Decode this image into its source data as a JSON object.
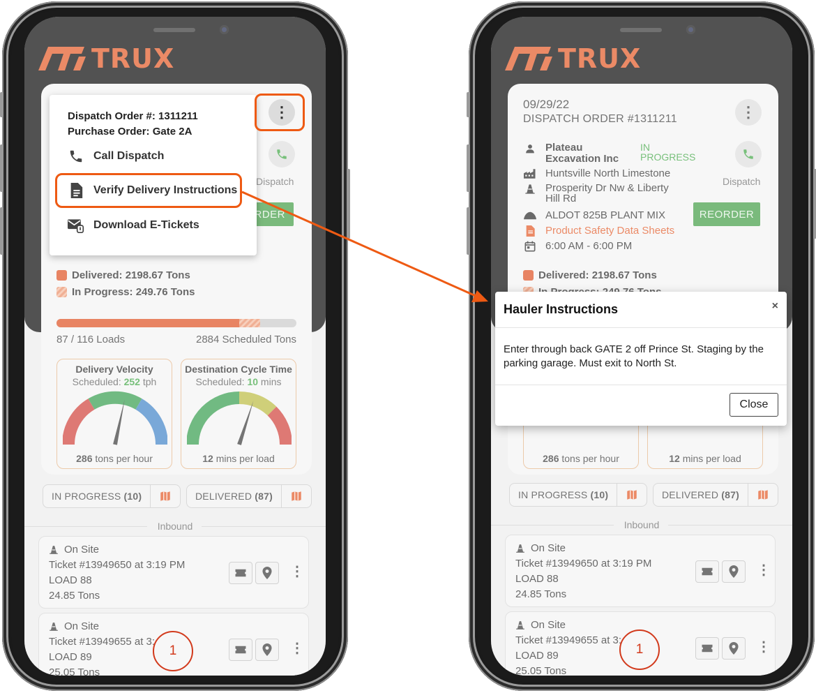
{
  "app": {
    "logo_text": "TRUX"
  },
  "left": {
    "menu": {
      "dispatch_order": "Dispatch Order #: 1311211",
      "purchase_order": "Purchase Order: Gate 2A",
      "call_dispatch": "Call Dispatch",
      "verify_instructions": "Verify Delivery Instructions",
      "download_etickets": "Download E-Tickets"
    }
  },
  "order": {
    "date": "09/29/22",
    "title": "DISPATCH ORDER #1311211",
    "customer": "Plateau Excavation Inc",
    "status": "IN PROGRESS",
    "plant": "Huntsville North Limestone",
    "location": "Prosperity Dr Nw & Liberty Hill Rd",
    "material": "ALDOT 825B PLANT MIX",
    "safety_link": "Product Safety Data Sheets",
    "hours": "6:00 AM - 6:00 PM",
    "dispatch_label": "Dispatch",
    "reorder_label": "REORDER",
    "reorder_partial": "RDER"
  },
  "progress": {
    "delivered_label": "Delivered: 2198.67 Tons",
    "in_progress_label": "In Progress: 249.76 Tons",
    "in_progress_partial": "In Progress: 249.76 Tons",
    "delivered_fraction": 0.762,
    "in_progress_fraction": 0.087,
    "loads_text": "87 / 116 Loads",
    "scheduled_text": "2884 Scheduled Tons"
  },
  "gauges": [
    {
      "title": "Delivery Velocity",
      "sub_prefix": "Scheduled:",
      "sub_value": "252",
      "sub_unit": "tph",
      "foot_value": "286",
      "foot_unit": "tons per hour",
      "needle_deg": 12
    },
    {
      "title": "Destination Cycle Time",
      "sub_prefix": "Scheduled:",
      "sub_value": "10",
      "sub_unit": "mins",
      "foot_value": "12",
      "foot_unit": "mins per load",
      "needle_deg": 18
    }
  ],
  "filters": {
    "in_progress": "IN PROGRESS",
    "in_progress_count": "(10)",
    "delivered": "DELIVERED",
    "delivered_count": "(87)"
  },
  "inbound_label": "Inbound",
  "loads": [
    {
      "status": "On Site",
      "ticket": "Ticket #13949650 at 3:19 PM",
      "load": "LOAD 88",
      "tons": "24.85 Tons"
    },
    {
      "status": "On Site",
      "ticket": "Ticket #13949655 at 3:",
      "load": "LOAD 89",
      "tons": "25.05 Tons"
    }
  ],
  "fab_count": "1",
  "modal": {
    "title": "Hauler Instructions",
    "close_x": "×",
    "body": "Enter through back GATE 2 off Prince St. Staging by the parking garage. Must exit to North St.",
    "close_button": "Close"
  },
  "colors": {
    "brand_orange": "#e2531e",
    "green": "#39a23d",
    "highlight": "#ee5a13"
  }
}
